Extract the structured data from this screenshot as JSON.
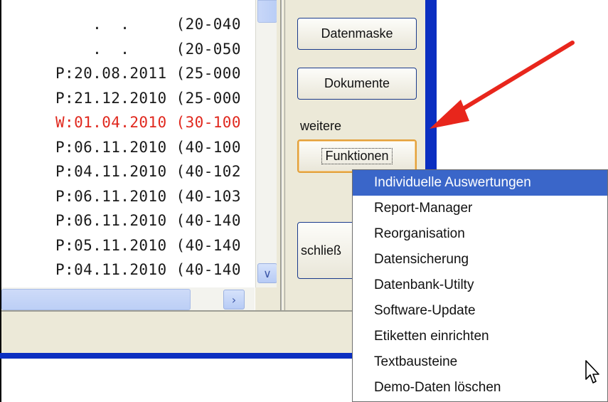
{
  "list": {
    "rows": [
      {
        "text": "    .  .     (20-040",
        "red": false
      },
      {
        "text": "    .  .     (20-050",
        "red": false
      },
      {
        "text": "P:20.08.2011 (25-000",
        "red": false
      },
      {
        "text": "P:21.12.2010 (25-000",
        "red": false
      },
      {
        "text": "W:01.04.2010 (30-100",
        "red": true
      },
      {
        "text": "P:06.11.2010 (40-100",
        "red": false
      },
      {
        "text": "P:04.11.2010 (40-102",
        "red": false
      },
      {
        "text": "P:06.11.2010 (40-103",
        "red": false
      },
      {
        "text": "P:06.11.2010 (40-140",
        "red": false
      },
      {
        "text": "P:05.11.2010 (40-140",
        "red": false
      },
      {
        "text": "P:04.11.2010 (40-140",
        "red": false
      }
    ]
  },
  "buttons": {
    "datenmaske": "Datenmaske",
    "dokumente": "Dokumente",
    "weitere_label": "weitere",
    "funktionen": "Funktionen",
    "schliessen": "schließ"
  },
  "menu": {
    "items": [
      "Individuelle Auswertungen",
      "Report-Manager",
      "Reorganisation",
      "Datensicherung",
      "Datenbank-Utilty",
      "Software-Update",
      "Etiketten einrichten",
      "Textbausteine",
      "Demo-Daten löschen"
    ],
    "highlighted_index": 0
  },
  "colors": {
    "accent_blue": "#0b2fc1",
    "highlight": "#3a66c9",
    "arrow_red": "#e8261c",
    "list_red": "#e0281e"
  },
  "icons": {
    "vscroll_down": "chevron-down-icon",
    "hscroll_right": "chevron-right-icon",
    "cursor": "mouse-pointer-icon",
    "arrow": "red-arrow-icon"
  }
}
